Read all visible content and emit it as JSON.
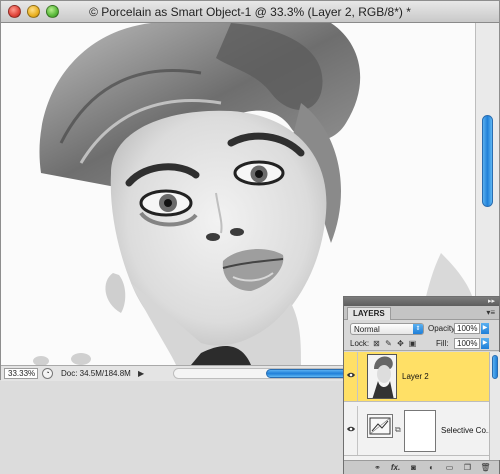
{
  "document": {
    "title": "© Porcelain as Smart Object-1 @ 33.3% (Layer 2, RGB/8*) *",
    "zoom": "33.33%",
    "doc_size": "Doc: 34.5M/184.8M"
  },
  "layers_panel": {
    "tab_label": "LAYERS",
    "blend_mode": "Normal",
    "opacity_label": "Opacity:",
    "opacity_value": "100%",
    "lock_label": "Lock:",
    "fill_label": "Fill:",
    "fill_value": "100%",
    "layers": [
      {
        "name": "Layer 2",
        "selected": true
      },
      {
        "name": "Selective Co...",
        "selected": false
      }
    ]
  },
  "colors": {
    "selected_layer": "#ffe066",
    "scroll_accent": "#1f7fd8"
  },
  "icons": [
    "close-button",
    "minimize-button",
    "zoom-button",
    "eye-icon",
    "link-icon",
    "fx-icon",
    "mask-icon",
    "adjustment-icon",
    "folder-icon",
    "new-layer-icon",
    "trash-icon"
  ]
}
